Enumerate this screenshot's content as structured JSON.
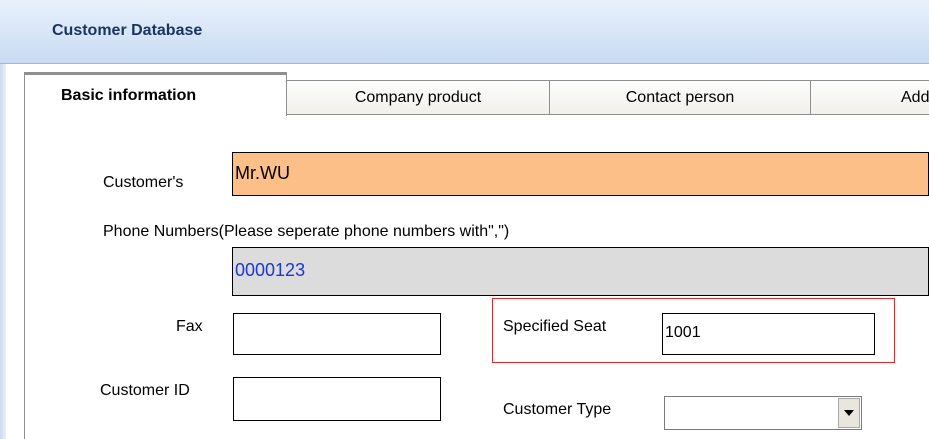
{
  "window": {
    "title": "Customer Database"
  },
  "tabs": [
    {
      "label": "Basic information",
      "active": true
    },
    {
      "label": "Company product",
      "active": false
    },
    {
      "label": "Contact person",
      "active": false
    },
    {
      "label": "Add",
      "active": false
    }
  ],
  "form": {
    "customer_name_label": "Customer's",
    "customer_name_value": "Mr.WU",
    "phone_label": "Phone Numbers(Please seperate phone numbers with\",\")",
    "phone_value": "0000123",
    "fax_label": "Fax",
    "fax_value": "",
    "specified_seat_label": "Specified Seat",
    "specified_seat_value": "1001",
    "customer_id_label": "Customer ID",
    "customer_id_value": "",
    "customer_type_label": "Customer Type",
    "customer_type_value": ""
  },
  "colors": {
    "name_field_bg": "#fbbf87",
    "phone_field_bg": "#dcdcdc",
    "phone_text": "#1a38d6",
    "highlight_border": "#e02b2b",
    "active_tab_accent": "#f0b337"
  },
  "icons": {
    "dropdown": "chevron-down-icon"
  }
}
